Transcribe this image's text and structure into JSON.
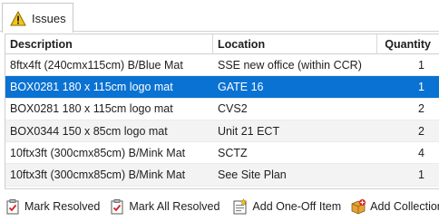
{
  "tab": {
    "label": "Issues",
    "icon": "warning-icon"
  },
  "grid": {
    "columns": [
      "Description",
      "Location",
      "Quantity"
    ],
    "rows": [
      {
        "description": "8ftx4ft (240cmx115cm) B/Blue Mat",
        "location": "SSE new office (within CCR)",
        "quantity": "1",
        "selected": false
      },
      {
        "description": "BOX0281 180 x 115cm logo mat",
        "location": "GATE 16",
        "quantity": "1",
        "selected": true
      },
      {
        "description": "BOX0281 180 x 115cm logo mat",
        "location": "CVS2",
        "quantity": "2",
        "selected": false
      },
      {
        "description": "BOX0344 150 x 85cm logo mat",
        "location": "Unit 21 ECT",
        "quantity": "2",
        "selected": false
      },
      {
        "description": "10ftx3ft (300cmx85cm) B/Mink Mat",
        "location": "SCTZ",
        "quantity": "4",
        "selected": false
      },
      {
        "description": "10ftx3ft (300cmx85cm) B/Mink Mat",
        "location": "See Site Plan",
        "quantity": "1",
        "selected": false
      }
    ]
  },
  "toolbar": {
    "mark_resolved": "Mark Resolved",
    "mark_all_resolved": "Mark All Resolved",
    "add_one_off_item": "Add One-Off Item",
    "add_collection": "Add Collection"
  },
  "colors": {
    "selection": "#0a72d2",
    "alt_row": "#f3f3f3"
  }
}
